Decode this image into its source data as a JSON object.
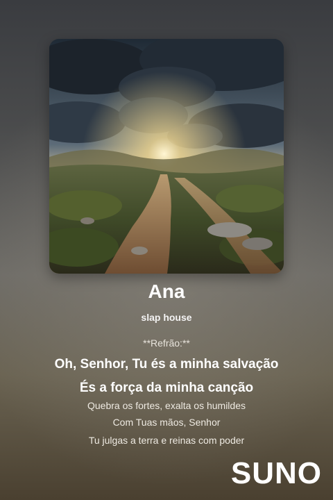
{
  "song": {
    "title": "Ana",
    "genre": "slap house"
  },
  "lyrics": {
    "refrain_label": "**Refrão:**",
    "line1": "Oh, Senhor, Tu és a minha salvação",
    "line2": "És a força da minha canção",
    "line3": "Quebra os fortes, exalta os humildes",
    "line4": "Com Tuas mãos, Senhor",
    "line5": "Tu julgas a terra e reinas com poder"
  },
  "brand": {
    "logo_text": "SUNO"
  }
}
